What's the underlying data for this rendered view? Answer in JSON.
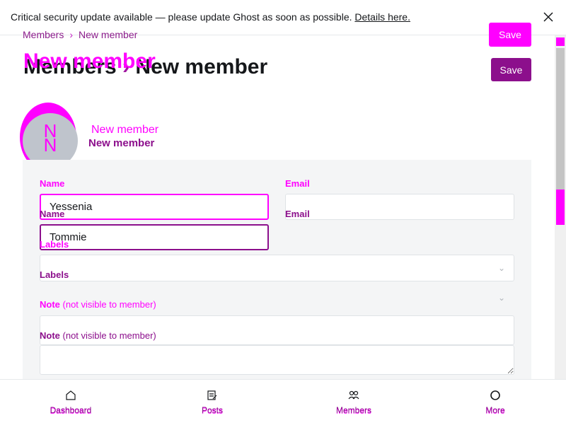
{
  "banner": {
    "text": "Critical security update available — please update Ghost as soon as possible.",
    "link": "Details here."
  },
  "breadcrumb": {
    "parent": "Members",
    "current": "New member"
  },
  "header": {
    "title_parent": "Members",
    "title_sep": "›",
    "title_current": "New member",
    "title_ghost": "New member",
    "save_label": "Save",
    "save_ghost_label": "Save"
  },
  "member": {
    "avatar_initial": "N",
    "name_ghost": "New member",
    "name": "New member"
  },
  "form": {
    "name_label": "Name",
    "name_value_ghost": "Yessenia",
    "name_value": "Tommie",
    "email_label": "Email",
    "email_value": "",
    "labels_label": "Labels",
    "note_label": "Note",
    "note_suffix": "(not visible to member)",
    "note_value": ""
  },
  "nav": {
    "items": [
      {
        "label": "Dashboard",
        "icon": "home-icon"
      },
      {
        "label": "Posts",
        "icon": "posts-icon"
      },
      {
        "label": "Members",
        "icon": "members-icon"
      },
      {
        "label": "More",
        "icon": "more-icon"
      }
    ]
  },
  "colors": {
    "accent": "#ff00ff",
    "accent_dark": "#8c0f8c",
    "card_bg": "#f4f5f6"
  }
}
